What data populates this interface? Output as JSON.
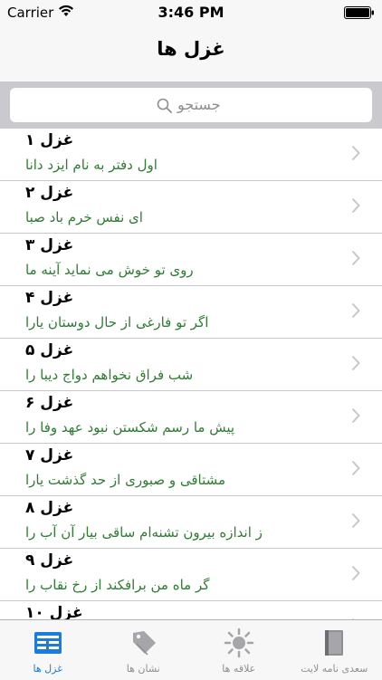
{
  "status": {
    "carrier": "Carrier",
    "time": "3:46 PM"
  },
  "nav": {
    "title": "غزل ها"
  },
  "search": {
    "placeholder": "جستجو"
  },
  "rows": [
    {
      "head": "غزل ۱",
      "sub": "اول دفتر به نام ایزد دانا"
    },
    {
      "head": "غزل ۲",
      "sub": "ای نفس خرم باد صبا"
    },
    {
      "head": "غزل ۳",
      "sub": "روی تو خوش می نماید آینه ما"
    },
    {
      "head": "غزل ۴",
      "sub": "اگر تو فارغی از حال دوستان یارا"
    },
    {
      "head": "غزل ۵",
      "sub": "شب فراق نخواهم دواج دیبا را"
    },
    {
      "head": "غزل ۶",
      "sub": "پیش ما رسم شکستن نبود عهد وفا را"
    },
    {
      "head": "غزل ۷",
      "sub": "مشتاقی و صبوری از حد گذشت یارا"
    },
    {
      "head": "غزل ۸",
      "sub": "ز اندازه بیرون تشنه‌ام ساقی بیار آن آب را"
    },
    {
      "head": "غزل ۹",
      "sub": "گر ماه من برافکند از رخ نقاب را"
    },
    {
      "head": "غزل ۱۰",
      "sub": ""
    }
  ],
  "tabs": [
    {
      "label": "غزل ها",
      "icon": "list-icon",
      "active": true
    },
    {
      "label": "نشان ها",
      "icon": "tag-icon",
      "active": false
    },
    {
      "label": "علاقه ها",
      "icon": "sun-icon",
      "active": false
    },
    {
      "label": "سعدی نامه لایت",
      "icon": "book-icon",
      "active": false
    }
  ],
  "colors": {
    "accent": "#1a7ce0",
    "subtitle": "#2e7d32"
  }
}
